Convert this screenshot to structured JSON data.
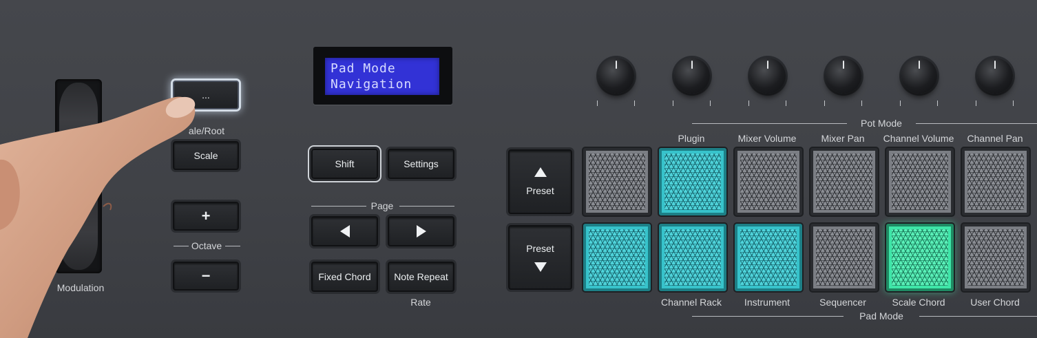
{
  "display": {
    "line1": "Pad Mode",
    "line2": "Navigation"
  },
  "left": {
    "modulation_label": "Modulation",
    "scale_root_label": "ale/Root",
    "dots_button": "...",
    "scale_button": "Scale",
    "octave_label": "Octave",
    "octave_up": "+",
    "octave_down": "−"
  },
  "center": {
    "shift": "Shift",
    "settings": "Settings",
    "page_label": "Page",
    "fixed_chord": "Fixed Chord",
    "note_repeat": "Note Repeat",
    "rate_label": "Rate"
  },
  "preset": {
    "up_label": "Preset",
    "down_label": "Preset"
  },
  "pot_mode": {
    "label": "Pot Mode",
    "items": [
      "Plugin",
      "Mixer Volume",
      "Mixer Pan",
      "Channel Volume",
      "Channel Pan"
    ]
  },
  "pad_mode": {
    "label": "Pad Mode",
    "items": [
      "Channel Rack",
      "Instrument",
      "Sequencer",
      "Scale Chord",
      "User Chord"
    ]
  },
  "pads": {
    "top": [
      "off",
      "cyan",
      "off",
      "off",
      "off",
      "off"
    ],
    "bottom": [
      "cyan",
      "cyan",
      "cyan",
      "off",
      "green",
      "off"
    ]
  },
  "colors": {
    "cyan": "#37c3cb",
    "green": "#3ee6a8",
    "lcd": "#3232d6",
    "panel": "#404247"
  }
}
